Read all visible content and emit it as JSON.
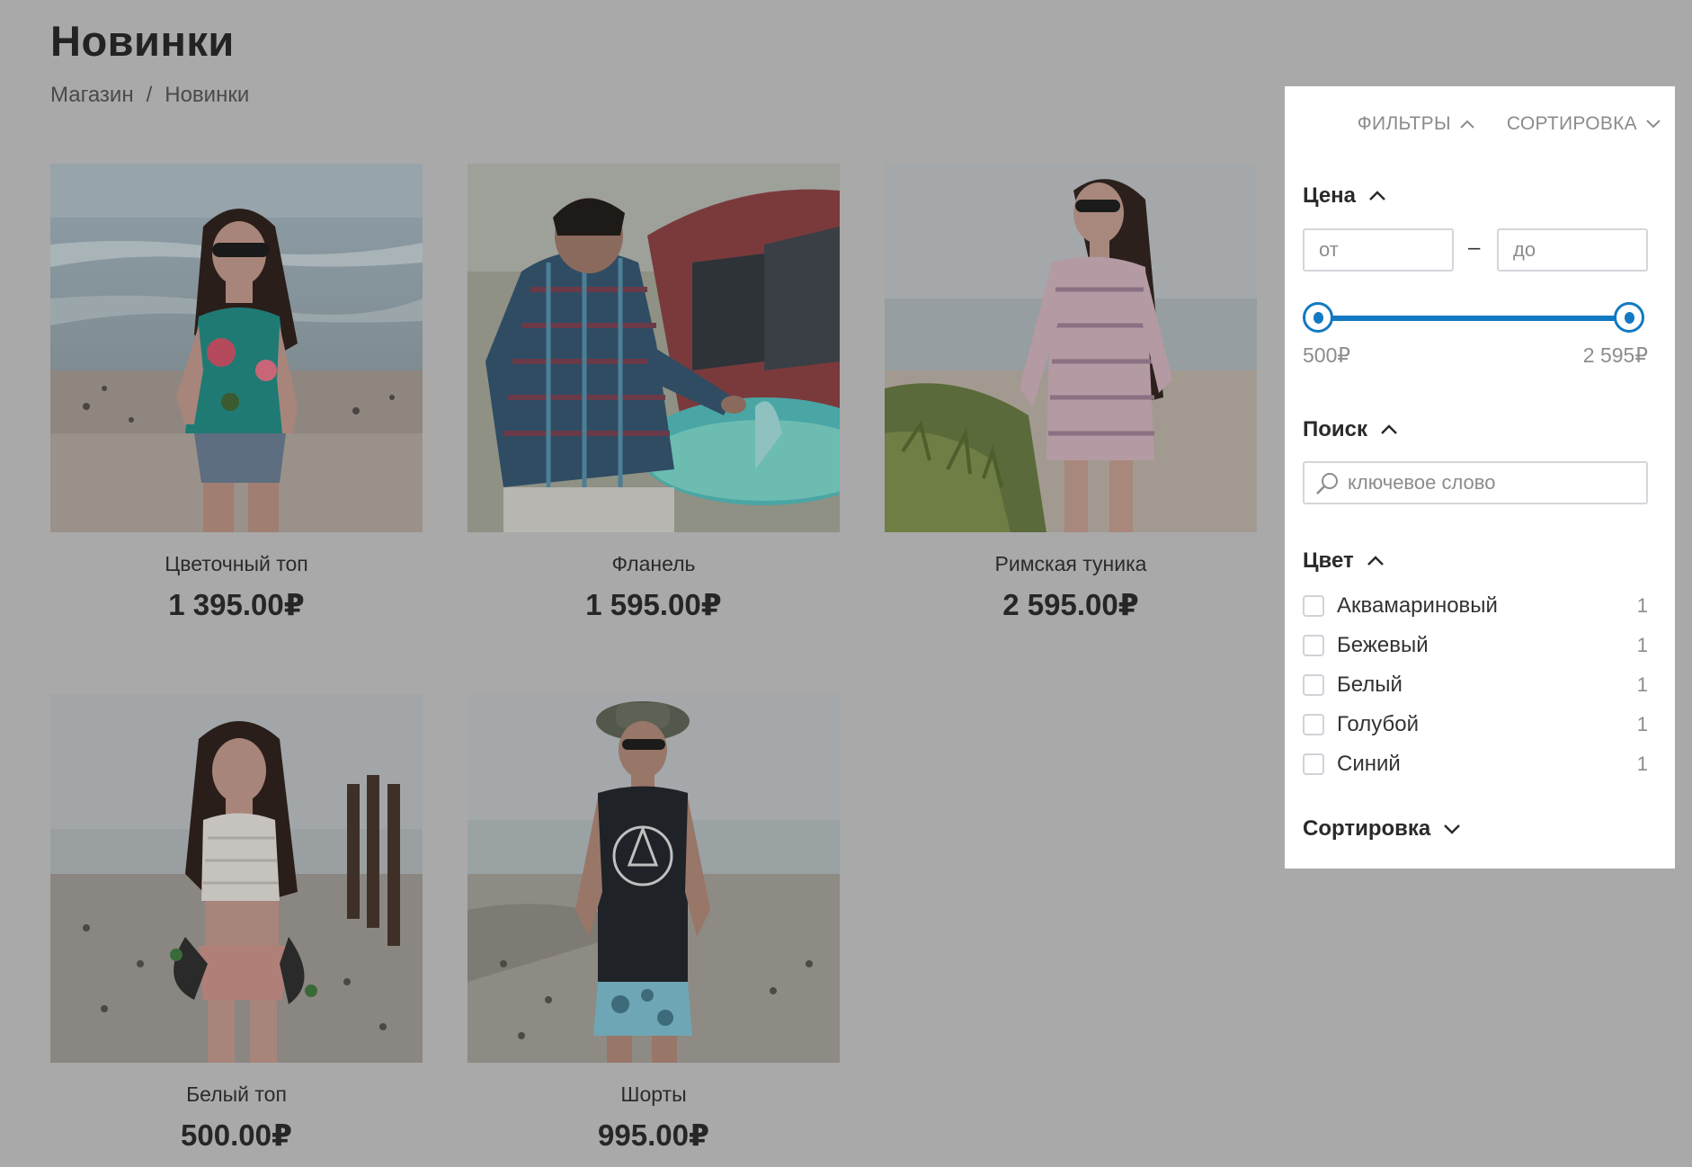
{
  "header": {
    "title": "Новинки",
    "breadcrumb": [
      "Магазин",
      "/",
      "Новинки"
    ]
  },
  "products": [
    {
      "name": "Цветочный топ",
      "price": "1 395.00₽"
    },
    {
      "name": "Фланель",
      "price": "1 595.00₽"
    },
    {
      "name": "Римская туника",
      "price": "2 595.00₽"
    },
    {
      "name": "Белый топ",
      "price": "500.00₽"
    },
    {
      "name": "Шорты",
      "price": "995.00₽"
    }
  ],
  "panel": {
    "filters_label": "ФИЛЬТРЫ",
    "sort_label": "СОРТИРОВКА",
    "price": {
      "title": "Цена",
      "from_placeholder": "от",
      "to_placeholder": "до",
      "dash": "–",
      "min_label": "500₽",
      "max_label": "2 595₽",
      "range_fraction": [
        0.0,
        1.0
      ]
    },
    "search": {
      "title": "Поиск",
      "placeholder": "ключевое слово"
    },
    "color": {
      "title": "Цвет",
      "items": [
        {
          "label": "Аквамариновый",
          "count": "1"
        },
        {
          "label": "Бежевый",
          "count": "1"
        },
        {
          "label": "Белый",
          "count": "1"
        },
        {
          "label": "Голубой",
          "count": "1"
        },
        {
          "label": "Синий",
          "count": "1"
        }
      ]
    },
    "sorting": {
      "title": "Сортировка"
    }
  },
  "colors": {
    "accent": "#1279c2",
    "overlay_background": "#a9a9a9",
    "panel_background": "#ffffff"
  },
  "icons": {
    "chevron_up": "chevron-up-icon",
    "chevron_down": "chevron-down-icon",
    "search": "search-icon"
  }
}
